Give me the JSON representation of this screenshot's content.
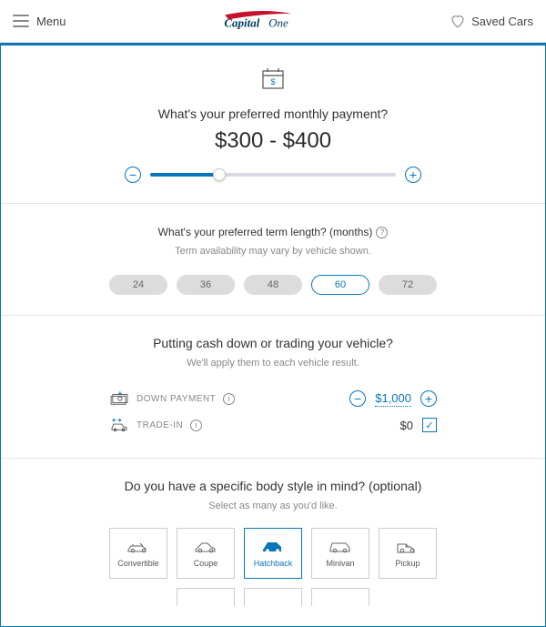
{
  "header": {
    "menu_label": "Menu",
    "saved_label": "Saved Cars"
  },
  "payment": {
    "question": "What's your preferred monthly payment?",
    "range": "$300 - $400"
  },
  "term": {
    "question": "What's your preferred term length? (months)",
    "hint": "Term availability may vary by vehicle shown.",
    "options": [
      "24",
      "36",
      "48",
      "60",
      "72"
    ],
    "selected": "60"
  },
  "cash": {
    "title": "Putting cash down or trading your vehicle?",
    "hint": "We'll apply them to each vehicle result.",
    "down_label": "DOWN PAYMENT",
    "down_value": "$1,000",
    "trade_label": "TRADE-IN",
    "trade_value": "$0"
  },
  "body": {
    "question": "Do you have a specific body style in mind? (optional)",
    "hint": "Select as many as you'd like.",
    "options": [
      "Convertible",
      "Coupe",
      "Hatchback",
      "Minivan",
      "Pickup"
    ],
    "selected": "Hatchback"
  }
}
